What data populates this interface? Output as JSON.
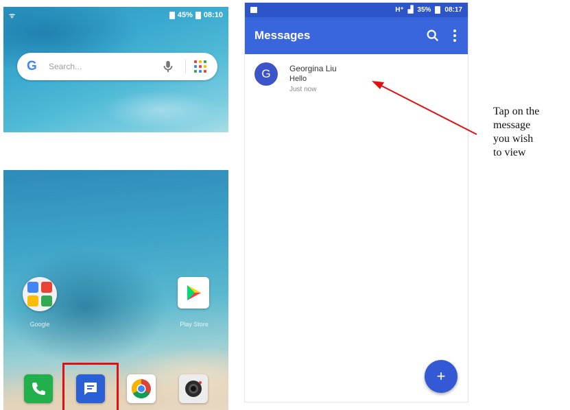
{
  "home_top": {
    "status_time": "08:10",
    "status_battery": "45%",
    "search_placeholder": "Search..."
  },
  "home_bottom": {
    "google_folder_label": "Google",
    "play_store_label": "Play Store"
  },
  "messages_app": {
    "status_time": "08:17",
    "status_battery": "35%",
    "status_network": "H⁺",
    "title": "Messages",
    "conversation": {
      "avatar_letter": "G",
      "contact": "Georgina Liu",
      "snippet": "Hello",
      "timestamp": "Just now"
    },
    "fab_symbol": "+"
  },
  "annotation": {
    "lines": [
      "Tap on the",
      "message",
      "you wish",
      "to view"
    ]
  },
  "colors": {
    "app_bar": "#3a66dd",
    "status_bar": "#2e55c7",
    "highlight": "#e01010",
    "arrow": "#e01010"
  }
}
